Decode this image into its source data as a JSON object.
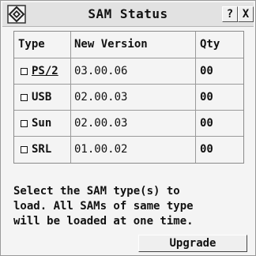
{
  "window": {
    "title": "SAM Status",
    "help_label": "?",
    "close_label": "X"
  },
  "table": {
    "headers": {
      "type": "Type",
      "version": "New Version",
      "qty": "Qty"
    },
    "rows": [
      {
        "type": "PS/2",
        "version": "03.00.06",
        "qty": "00",
        "checked": false
      },
      {
        "type": "USB",
        "version": "02.00.03",
        "qty": "00",
        "checked": false
      },
      {
        "type": "Sun",
        "version": "02.00.03",
        "qty": "00",
        "checked": false
      },
      {
        "type": "SRL",
        "version": "01.00.02",
        "qty": "00",
        "checked": false
      }
    ]
  },
  "message": "Select the SAM type(s) to\nload. All SAMs of same type\nwill be loaded at one time.",
  "upgrade_label": "Upgrade"
}
